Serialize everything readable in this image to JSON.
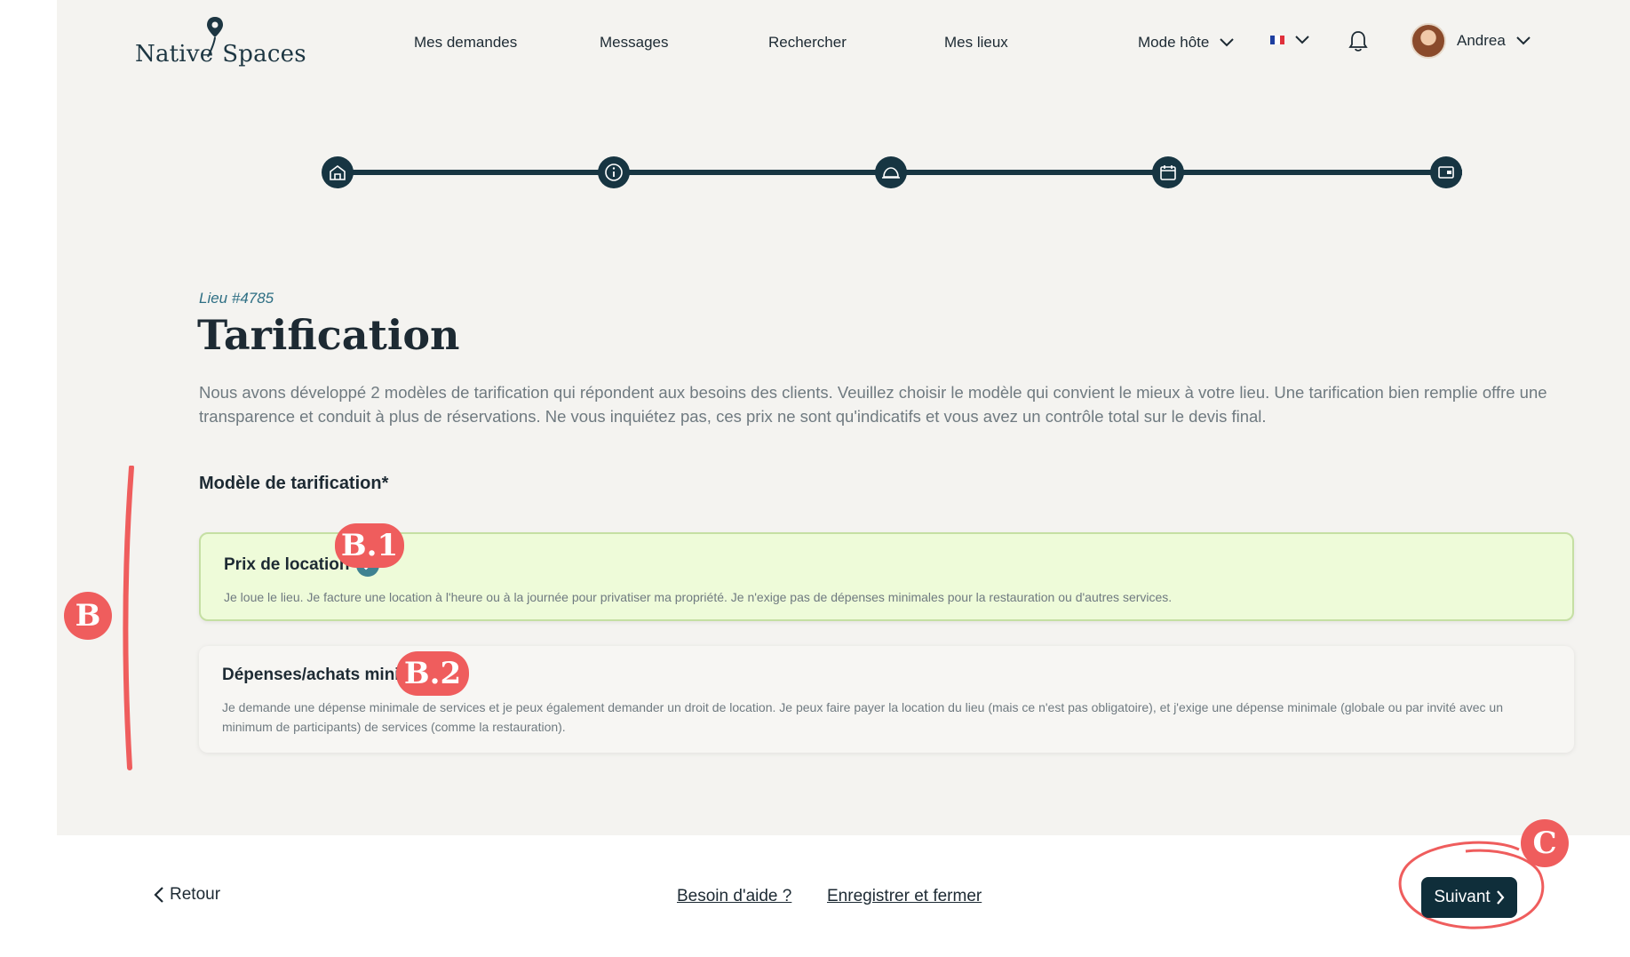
{
  "header": {
    "logo": {
      "text_left": "Native",
      "text_right": "Spaces"
    },
    "nav": [
      {
        "label": "Mes demandes"
      },
      {
        "label": "Messages"
      },
      {
        "label": "Rechercher"
      },
      {
        "label": "Mes lieux"
      }
    ],
    "mode_label": "Mode hôte",
    "language_flag": [
      "#1f3fa0",
      "#ffffff",
      "#e0303b"
    ],
    "user_name": "Andrea"
  },
  "stepper": {
    "steps": [
      "home-icon",
      "info-icon",
      "cloche-icon",
      "calendar-icon",
      "wallet-icon"
    ],
    "color": "#173542"
  },
  "page": {
    "lieu_id": "Lieu #4785",
    "title": "Tarification",
    "intro": "Nous avons développé 2 modèles de tarification qui répondent aux besoins des clients. Veuillez choisir le modèle qui convient le mieux à votre lieu. Une tarification bien remplie offre une transparence et conduit à plus de réservations. Ne vous inquiétez pas, ces prix ne sont qu'indicatifs et vous avez un contrôle total sur le devis final.",
    "section_label": "Modèle de tarification*"
  },
  "options": [
    {
      "title": "Prix de location",
      "selected": true,
      "description": "Je loue le lieu. Je facture une location à l'heure ou à la journée pour privatiser ma propriété. Je n'exige pas de dépenses minimales pour la restauration ou d'autres services."
    },
    {
      "title": "Dépenses/achats minimums",
      "selected": false,
      "description": "Je demande une dépense minimale de services et je peux également demander un droit de location. Je peux faire payer la location du lieu (mais ce n'est pas obligatoire), et j'exige une dépense minimale (globale ou par invité avec un minimum de participants) de services (comme la restauration)."
    }
  ],
  "annotations": {
    "b": "B",
    "b1": "B.1",
    "b2": "B.2",
    "c": "C",
    "color": "#ef5d5d"
  },
  "footer": {
    "back_label": "Retour",
    "help_label": "Besoin d'aide ?",
    "save_label": "Enregistrer et fermer",
    "next_label": "Suivant"
  },
  "colors": {
    "primary": "#0f2e3a",
    "selected_bg": "#eefbd9",
    "accent_teal": "#3f8291"
  }
}
